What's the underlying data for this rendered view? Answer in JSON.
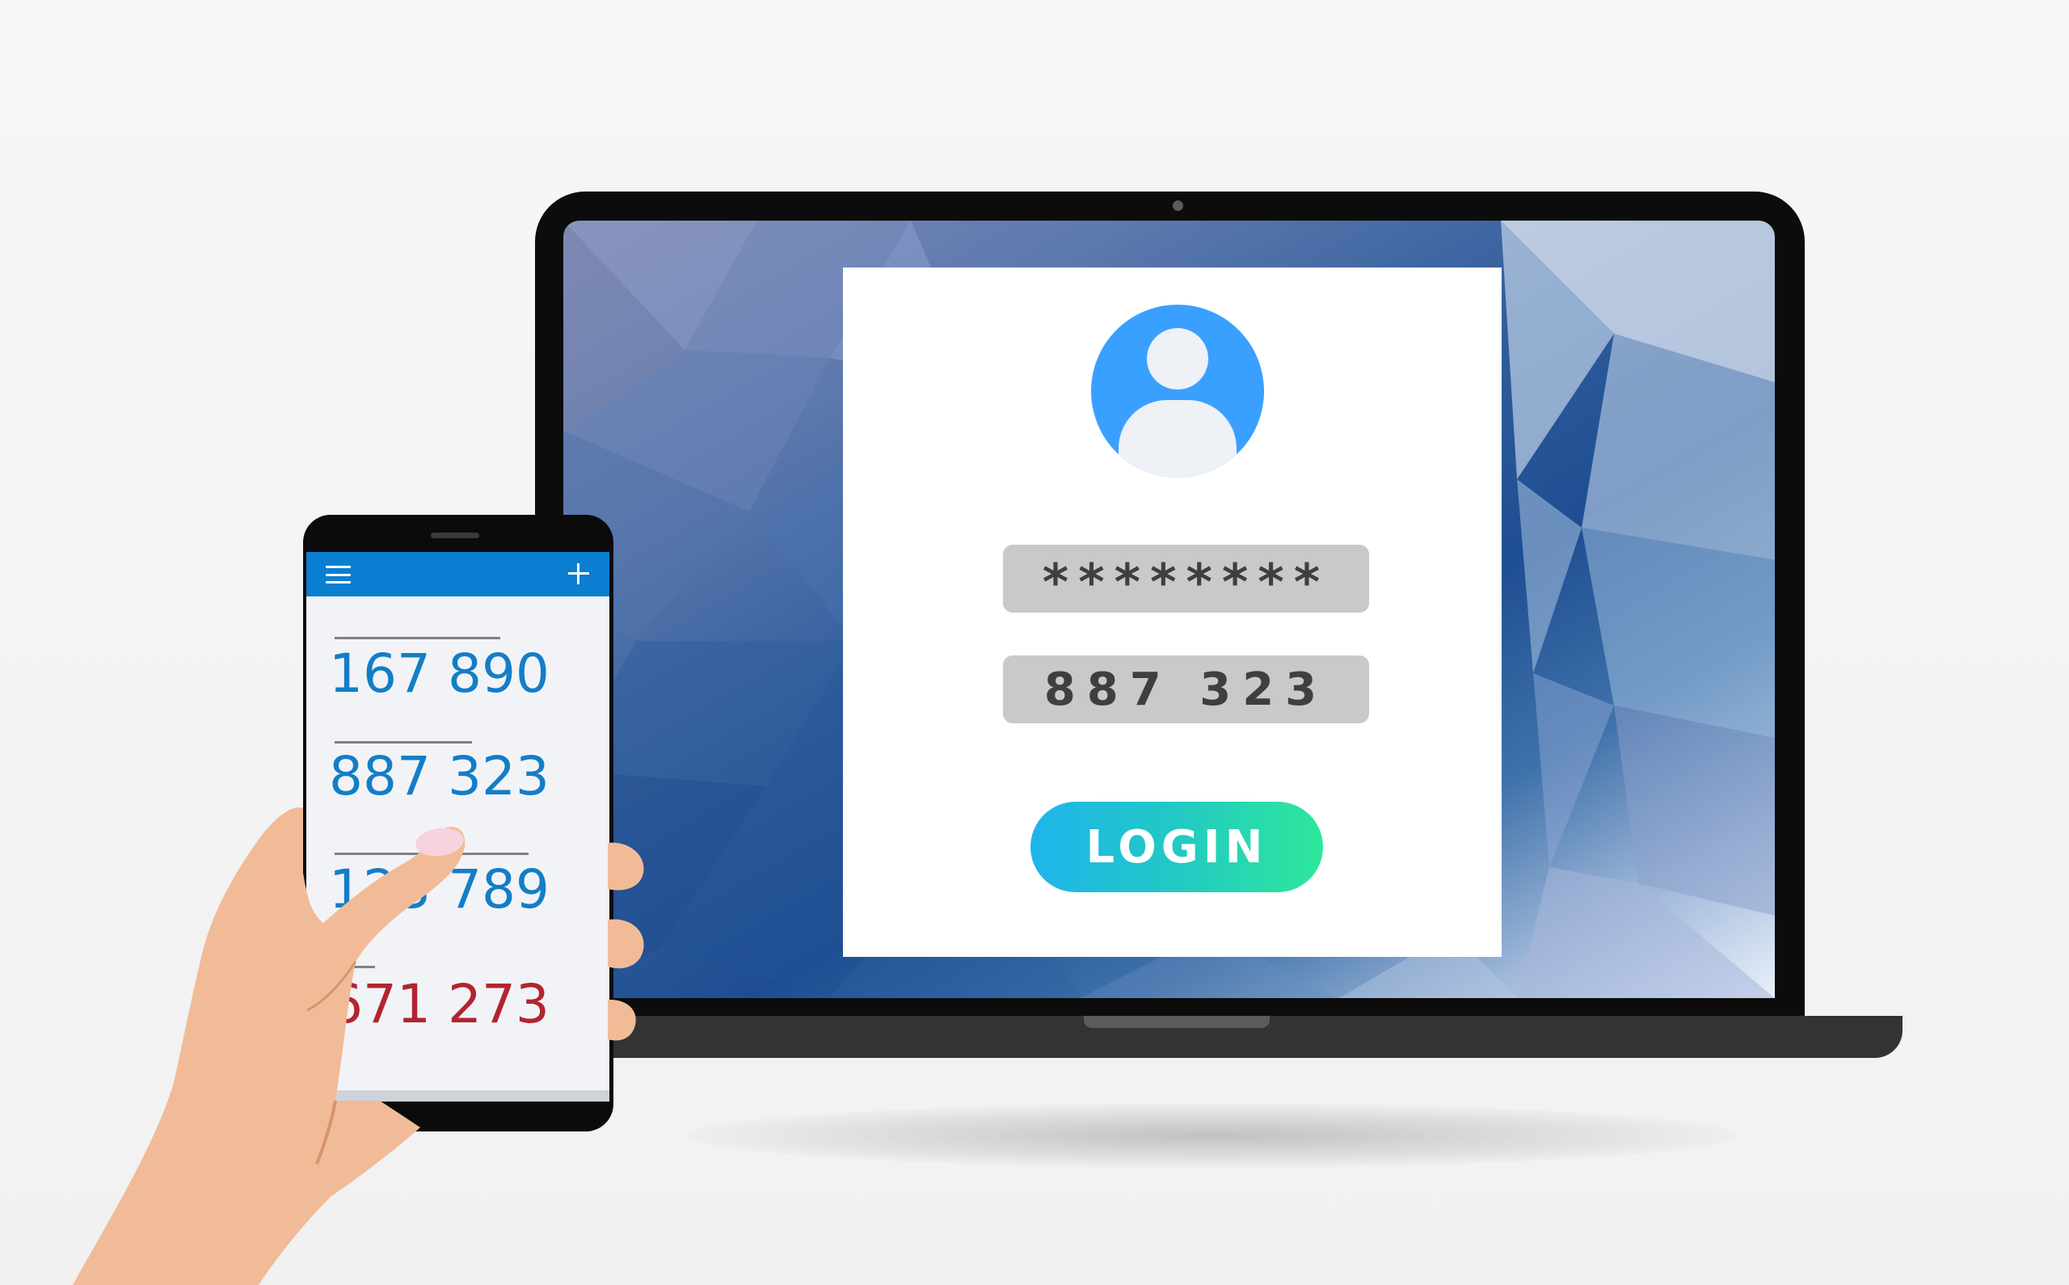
{
  "login_form": {
    "password_value": "********",
    "code_value": "887 323",
    "login_label": "LOGIN"
  },
  "phone_app": {
    "codes": [
      {
        "value": "167 890",
        "color": "#137ec6"
      },
      {
        "value": "887 323",
        "color": "#137ec6"
      },
      {
        "value": "123 789",
        "color": "#137ec6"
      },
      {
        "value": "671 273",
        "color": "#b32430"
      }
    ]
  },
  "icons": [
    "user-avatar-icon",
    "menu-icon",
    "plus-icon",
    "webcam-icon"
  ],
  "colors": {
    "appbar": "#0a7ed0",
    "avatar": "#3aa0ff",
    "code_blue": "#137ec6",
    "code_red": "#b32430",
    "login_gradient_start": "#1fb4ec",
    "login_gradient_end": "#2de89a"
  }
}
